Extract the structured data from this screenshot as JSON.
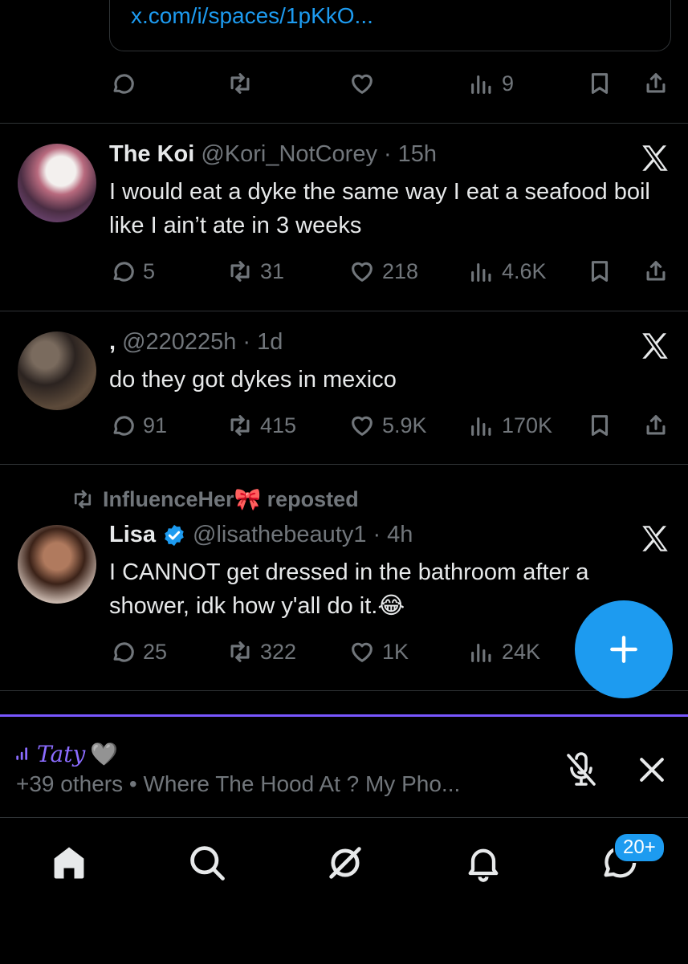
{
  "top_card": {
    "link": "x.com/i/spaces/1pKkO..."
  },
  "top_actions": {
    "views": "9"
  },
  "tweets": [
    {
      "name": "The Koi",
      "handle": "@Kori_NotCorey",
      "sep": "·",
      "time": "15h",
      "text": "I would eat a dyke the same way I eat a seafood boil like I ain’t ate in 3 weeks",
      "replies": "5",
      "reposts": "31",
      "likes": "218",
      "views": "4.6K"
    },
    {
      "name": ",",
      "handle": "@220225h",
      "sep": "·",
      "time": "1d",
      "text": "do they got dykes in mexico",
      "replies": "91",
      "reposts": "415",
      "likes": "5.9K",
      "views": "170K"
    },
    {
      "repost_by": "InfluenceHer🎀 reposted",
      "name": "Lisa",
      "handle": "@lisathebeauty1",
      "sep": "·",
      "time": "4h",
      "text": "I CANNOT get dressed in the bathroom after a shower, idk how y'all do it.😂",
      "replies": "25",
      "reposts": "322",
      "likes": "1K",
      "views": "24K"
    }
  ],
  "spaces": {
    "host": "Taty",
    "host_emoji": "🩶",
    "subtitle": "+39 others • Where The Hood At ? My Pho..."
  },
  "nav": {
    "messages_badge": "20+"
  },
  "colors": {
    "accent": "#1d9bf0",
    "spaces": "#7856ff",
    "muted": "#71767b",
    "background": "#000000"
  }
}
